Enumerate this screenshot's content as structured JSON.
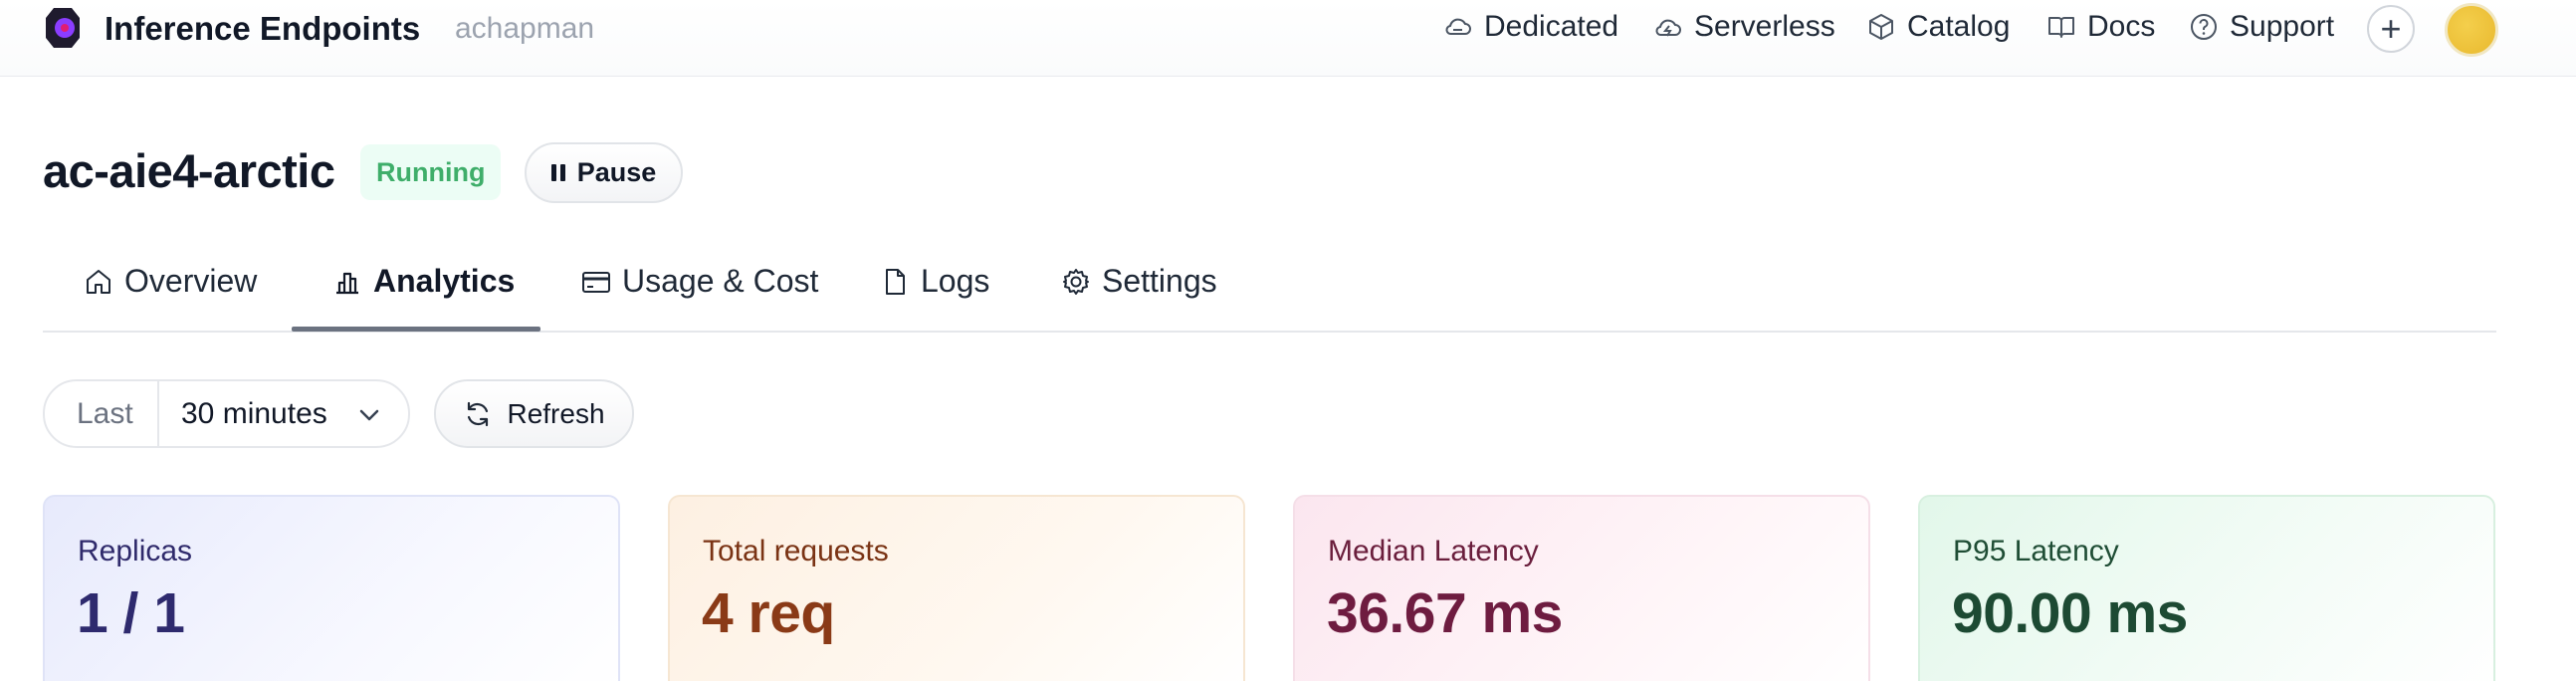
{
  "header": {
    "brand": "Inference Endpoints",
    "owner": "achapman",
    "nav": {
      "dedicated": "Dedicated",
      "serverless": "Serverless",
      "catalog": "Catalog",
      "docs": "Docs",
      "support": "Support"
    },
    "plus_label": "+"
  },
  "endpoint": {
    "name": "ac-aie4-arctic",
    "status": "Running",
    "pause_label": "Pause"
  },
  "tabs": [
    {
      "label": "Overview"
    },
    {
      "label": "Analytics",
      "active": true
    },
    {
      "label": "Usage & Cost"
    },
    {
      "label": "Logs"
    },
    {
      "label": "Settings"
    }
  ],
  "controls": {
    "range_prefix": "Last",
    "range_value": "30 minutes",
    "refresh_label": "Refresh"
  },
  "metrics": [
    {
      "label": "Replicas",
      "value": "1 / 1"
    },
    {
      "label": "Total requests",
      "value": "4 req"
    },
    {
      "label": "Median Latency",
      "value": "36.67 ms"
    },
    {
      "label": "P95 Latency",
      "value": "90.00 ms"
    }
  ],
  "colors": {
    "running_text": "#3fae6a",
    "running_bg": "#ecfdf5",
    "avatar": "#e9b92f",
    "logo": "#7c3aed"
  }
}
